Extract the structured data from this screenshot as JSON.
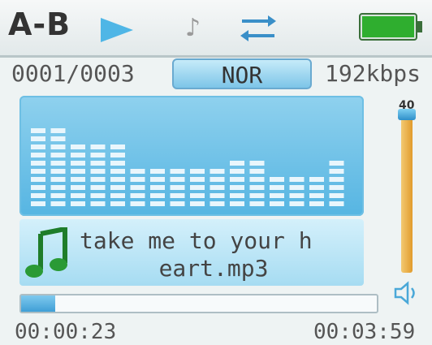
{
  "status_bar": {
    "ab_label": "A-B",
    "icons": [
      "play-icon",
      "note-icon",
      "repeat-icon",
      "battery-icon"
    ],
    "battery_level": 1.0
  },
  "info": {
    "track_counter": "0001/0003",
    "eq_mode": "NOR",
    "bitrate": "192kbps"
  },
  "spectrum": {
    "levels": [
      10,
      10,
      8,
      8,
      8,
      5,
      5,
      5,
      5,
      5,
      6,
      6,
      4,
      4,
      4,
      6
    ]
  },
  "song": {
    "line1": "take me to your h",
    "line2": "eart.mp3"
  },
  "volume": {
    "level": "40",
    "fraction": 1.0
  },
  "progress": {
    "elapsed": "00:00:23",
    "total": "00:03:59",
    "fraction": 0.096
  },
  "colors": {
    "accent": "#5bb8e4",
    "battery": "#2fae2f",
    "volume_bar": "#e8a93a"
  }
}
